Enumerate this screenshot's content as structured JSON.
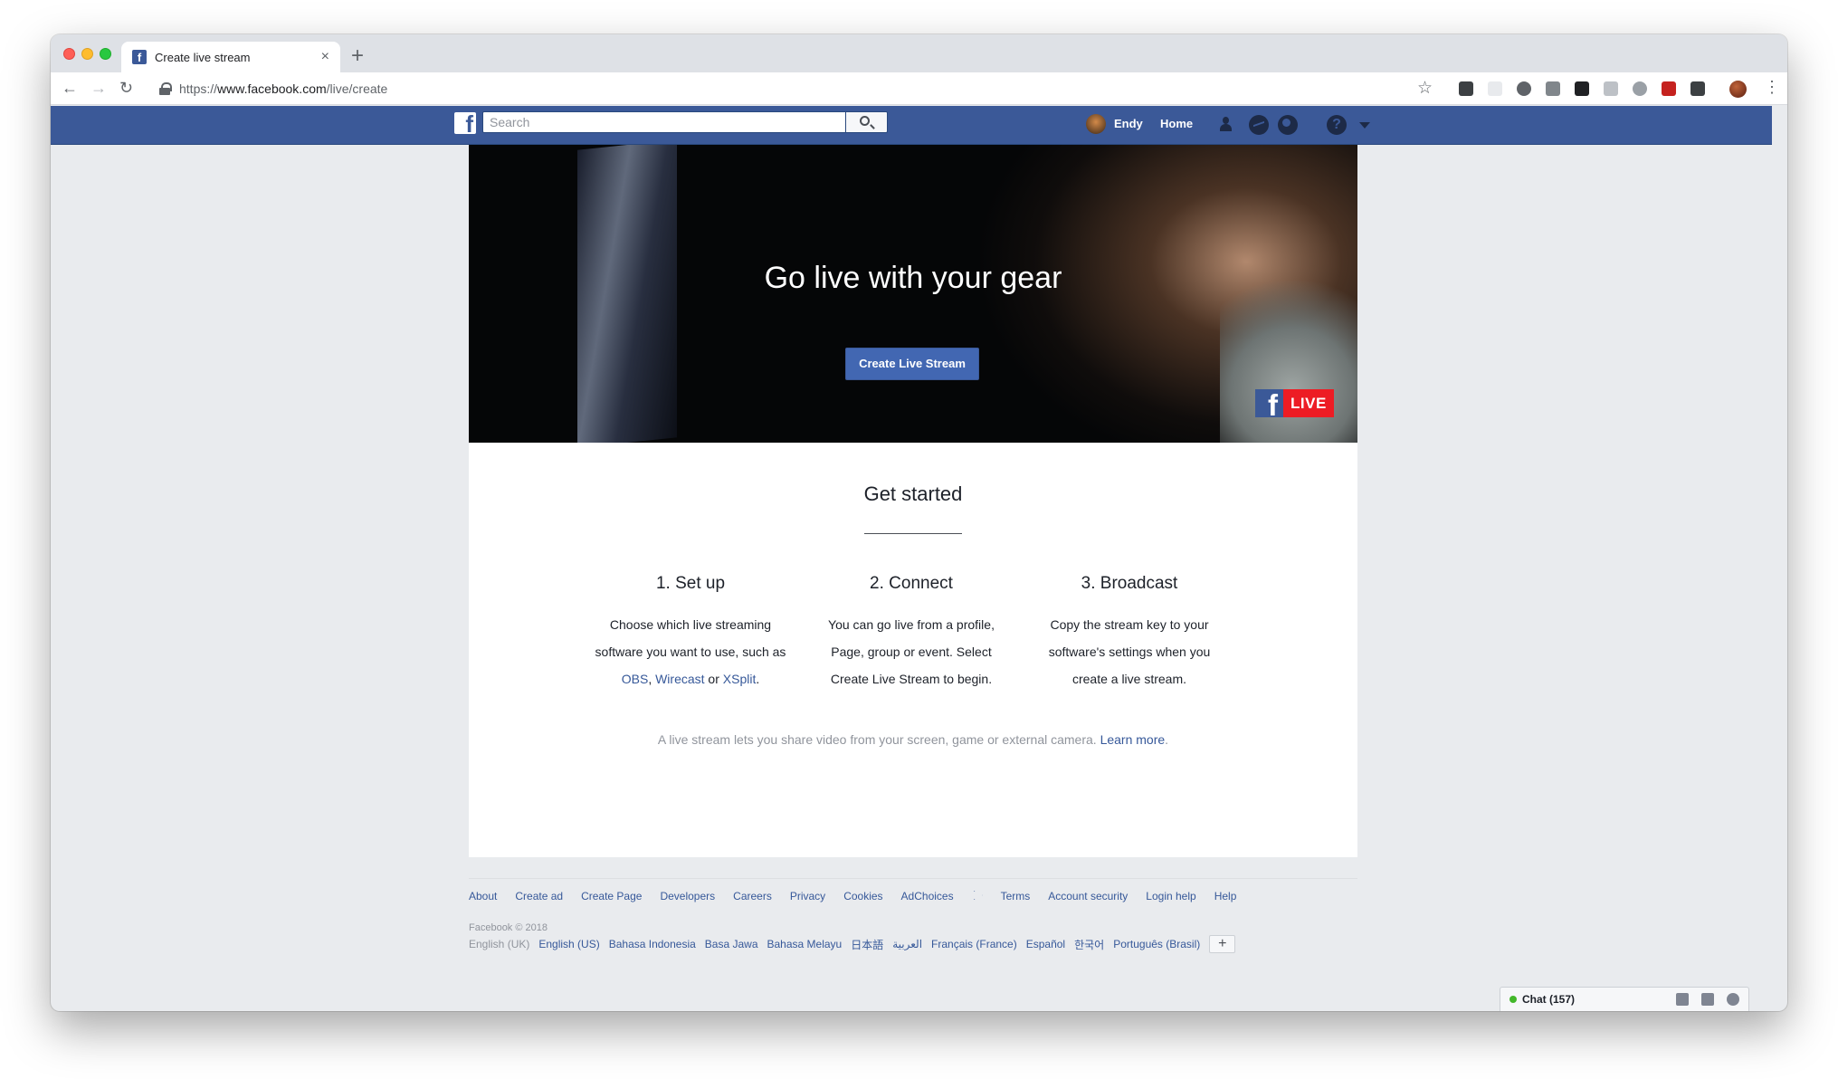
{
  "browser": {
    "tab_title": "Create live stream",
    "tab_close": "×",
    "new_tab": "+",
    "url_prefix": "https://",
    "url_domain": "www.facebook.com",
    "url_path": "/live/create",
    "back": "←",
    "forward": "→",
    "reload": "↻",
    "bookmark": "☆",
    "menu": "⋮"
  },
  "facebook_header": {
    "search_placeholder": "Search",
    "user_name": "Endy",
    "home_label": "Home",
    "help": "?"
  },
  "hero": {
    "title": "Go live with your gear",
    "cta_label": "Create Live Stream",
    "badge_text": "LIVE"
  },
  "get_started": {
    "title": "Get started",
    "steps": [
      {
        "heading": "1. Set up",
        "text_before": "Choose which live streaming software you want to use, such as ",
        "links": [
          "OBS",
          "Wirecast",
          "XSplit"
        ],
        "sep1": ", ",
        "sep2": " or ",
        "end": "."
      },
      {
        "heading": "2. Connect",
        "text": "You can go live from a profile, Page, group or event. Select Create Live Stream to begin."
      },
      {
        "heading": "3. Broadcast",
        "text": "Copy the stream key to your software's settings when you create a live stream."
      }
    ],
    "note_text": "A live stream lets you share video from your screen, game or external camera. ",
    "note_link": "Learn more",
    "note_end": "."
  },
  "footer": {
    "links": [
      "About",
      "Create ad",
      "Create Page",
      "Developers",
      "Careers",
      "Privacy",
      "Cookies",
      "AdChoices",
      "Terms",
      "Account security",
      "Login help",
      "Help"
    ],
    "copyright": "Facebook © 2018",
    "current_language": "English (UK)",
    "languages": [
      "English (US)",
      "Bahasa Indonesia",
      "Basa Jawa",
      "Bahasa Melayu",
      "日本語",
      "العربية",
      "Français (France)",
      "Español",
      "한국어",
      "Português (Brasil)"
    ],
    "more_languages": "+"
  },
  "chat": {
    "label": "Chat (157)"
  },
  "colors": {
    "facebook_blue": "#3b5998",
    "button_blue": "#4267b2",
    "link_blue": "#365899",
    "live_red": "#ed1c24",
    "page_bg": "#e9ebee"
  }
}
